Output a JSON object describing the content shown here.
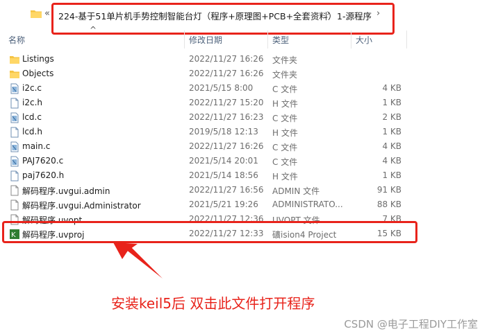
{
  "address_bar": {
    "back_glyph": "«",
    "crumb1": "224-基于51单片机手势控制智能台灯（程序+原理图+PCB+全套资料）",
    "crumb2": "1-源程序",
    "separator": "›"
  },
  "columns": {
    "name": "名称",
    "modified": "修改日期",
    "type": "类型",
    "size": "大小"
  },
  "files": [
    {
      "name": "Listings",
      "modified": "2022/11/27 16:26",
      "type": "文件夹",
      "size": "",
      "icon": "folder-icon"
    },
    {
      "name": "Objects",
      "modified": "2022/11/27 16:26",
      "type": "文件夹",
      "size": "",
      "icon": "folder-icon"
    },
    {
      "name": "i2c.c",
      "modified": "2021/5/15 8:00",
      "type": "C 文件",
      "size": "4 KB",
      "icon": "c-file-icon"
    },
    {
      "name": "i2c.h",
      "modified": "2022/11/27 15:20",
      "type": "H 文件",
      "size": "1 KB",
      "icon": "h-file-icon"
    },
    {
      "name": "lcd.c",
      "modified": "2022/11/27 16:23",
      "type": "C 文件",
      "size": "2 KB",
      "icon": "c-file-icon"
    },
    {
      "name": "lcd.h",
      "modified": "2019/5/18 12:13",
      "type": "H 文件",
      "size": "1 KB",
      "icon": "h-file-icon"
    },
    {
      "name": "main.c",
      "modified": "2022/11/27 16:26",
      "type": "C 文件",
      "size": "4 KB",
      "icon": "c-file-icon"
    },
    {
      "name": "PAJ7620.c",
      "modified": "2021/5/14 20:01",
      "type": "C 文件",
      "size": "4 KB",
      "icon": "c-file-icon"
    },
    {
      "name": "paj7620.h",
      "modified": "2021/5/14 18:56",
      "type": "H 文件",
      "size": "1 KB",
      "icon": "h-file-icon"
    },
    {
      "name": "解码程序.uvgui.admin",
      "modified": "2022/11/27 16:56",
      "type": "ADMIN 文件",
      "size": "91 KB",
      "icon": "generic-file-icon"
    },
    {
      "name": "解码程序.uvgui.Administrator",
      "modified": "2021/5/21 19:26",
      "type": "ADMINISTRATO...",
      "size": "88 KB",
      "icon": "generic-file-icon"
    },
    {
      "name": "解码程序.uvopt",
      "modified": "2022/11/27 12:36",
      "type": "UVOPT 文件",
      "size": "7 KB",
      "icon": "generic-file-icon"
    },
    {
      "name": "解码程序.uvproj",
      "modified": "2022/11/27 12:33",
      "type": "礦ision4 Project",
      "size": "15 KB",
      "icon": "keil-project-icon"
    }
  ],
  "annotation": {
    "note": "安装keil5后  双击此文件打开程序",
    "color": "#e8231b"
  },
  "watermark": "CSDN @电子工程DIY工作室"
}
